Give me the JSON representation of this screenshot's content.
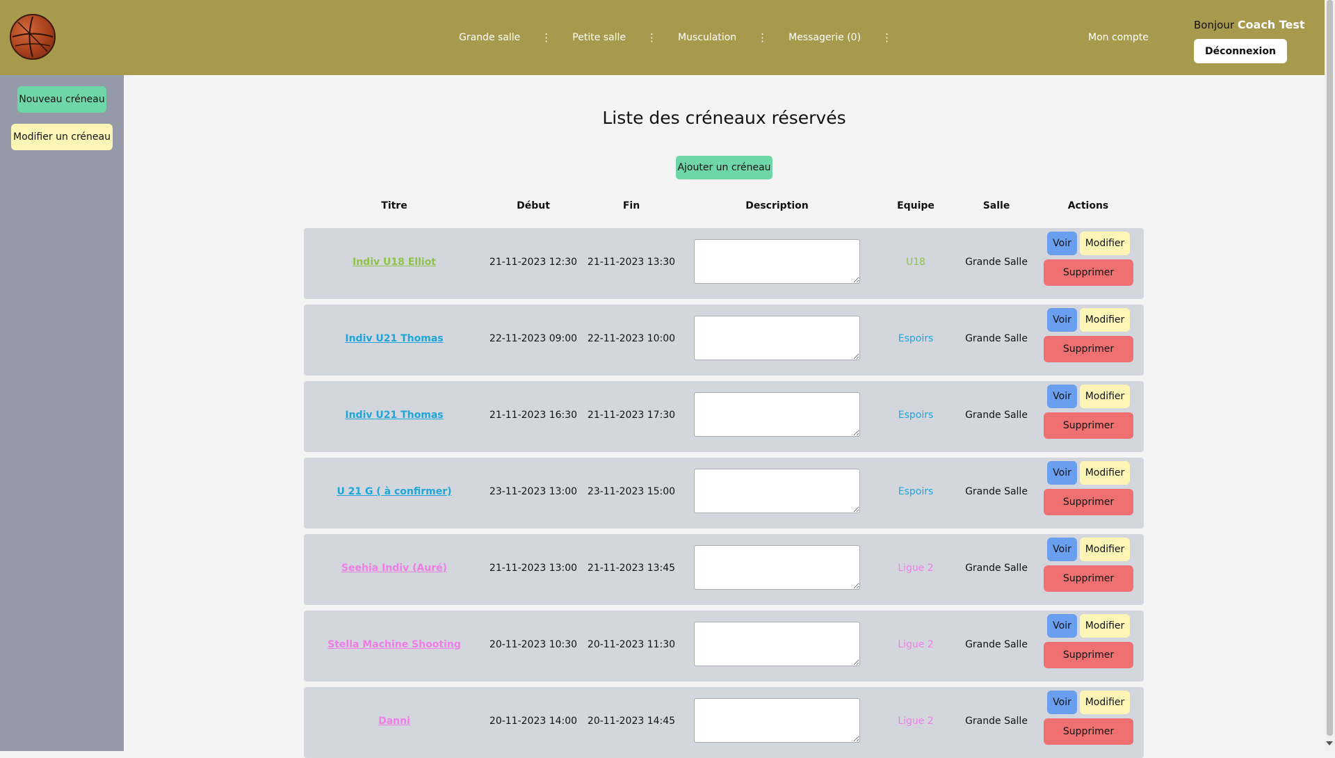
{
  "header": {
    "nav": [
      {
        "label": "Grande salle"
      },
      {
        "label": "Petite salle"
      },
      {
        "label": "Musculation"
      },
      {
        "label": "Messagerie (0)"
      }
    ],
    "account_label": "Mon compte",
    "greeting_prefix": "Bonjour",
    "user_name": "Coach Test",
    "logout_label": "Déconnexion"
  },
  "sidebar": {
    "new_label": "Nouveau créneau",
    "edit_label": "Modifier un créneau"
  },
  "main": {
    "title": "Liste des créneaux réservés",
    "add_label": "Ajouter un créneau",
    "columns": {
      "title": "Titre",
      "start": "Début",
      "end": "Fin",
      "description": "Description",
      "team": "Equipe",
      "room": "Salle",
      "actions": "Actions"
    },
    "action_labels": {
      "view": "Voir",
      "edit": "Modifier",
      "delete": "Supprimer"
    },
    "rows": [
      {
        "title": "Indiv U18 Elliot",
        "start": "21-11-2023 12:30",
        "end": "21-11-2023 13:30",
        "description": "",
        "team": "U18",
        "room": "Grande Salle",
        "color": "#8fc24a"
      },
      {
        "title": "Indiv U21 Thomas",
        "start": "22-11-2023 09:00",
        "end": "22-11-2023 10:00",
        "description": "",
        "team": "Espoirs",
        "room": "Grande Salle",
        "color": "#1fa6d8"
      },
      {
        "title": "Indiv U21 Thomas",
        "start": "21-11-2023 16:30",
        "end": "21-11-2023 17:30",
        "description": "",
        "team": "Espoirs",
        "room": "Grande Salle",
        "color": "#1fa6d8"
      },
      {
        "title": "U 21 G ( à confirmer)",
        "start": "23-11-2023 13:00",
        "end": "23-11-2023 15:00",
        "description": "",
        "team": "Espoirs",
        "room": "Grande Salle",
        "color": "#1fa6d8"
      },
      {
        "title": "Seehia Indiv (Auré)",
        "start": "21-11-2023 13:00",
        "end": "21-11-2023 13:45",
        "description": "",
        "team": "Ligue 2",
        "room": "Grande Salle",
        "color": "#ee7ee6"
      },
      {
        "title": "Stella Machine Shooting",
        "start": "20-11-2023 10:30",
        "end": "20-11-2023 11:30",
        "description": "",
        "team": "Ligue 2",
        "room": "Grande Salle",
        "color": "#ee7ee6"
      },
      {
        "title": "Danni",
        "start": "20-11-2023 14:00",
        "end": "20-11-2023 14:45",
        "description": "",
        "team": "Ligue 2",
        "room": "Grande Salle",
        "color": "#ee7ee6"
      }
    ]
  }
}
